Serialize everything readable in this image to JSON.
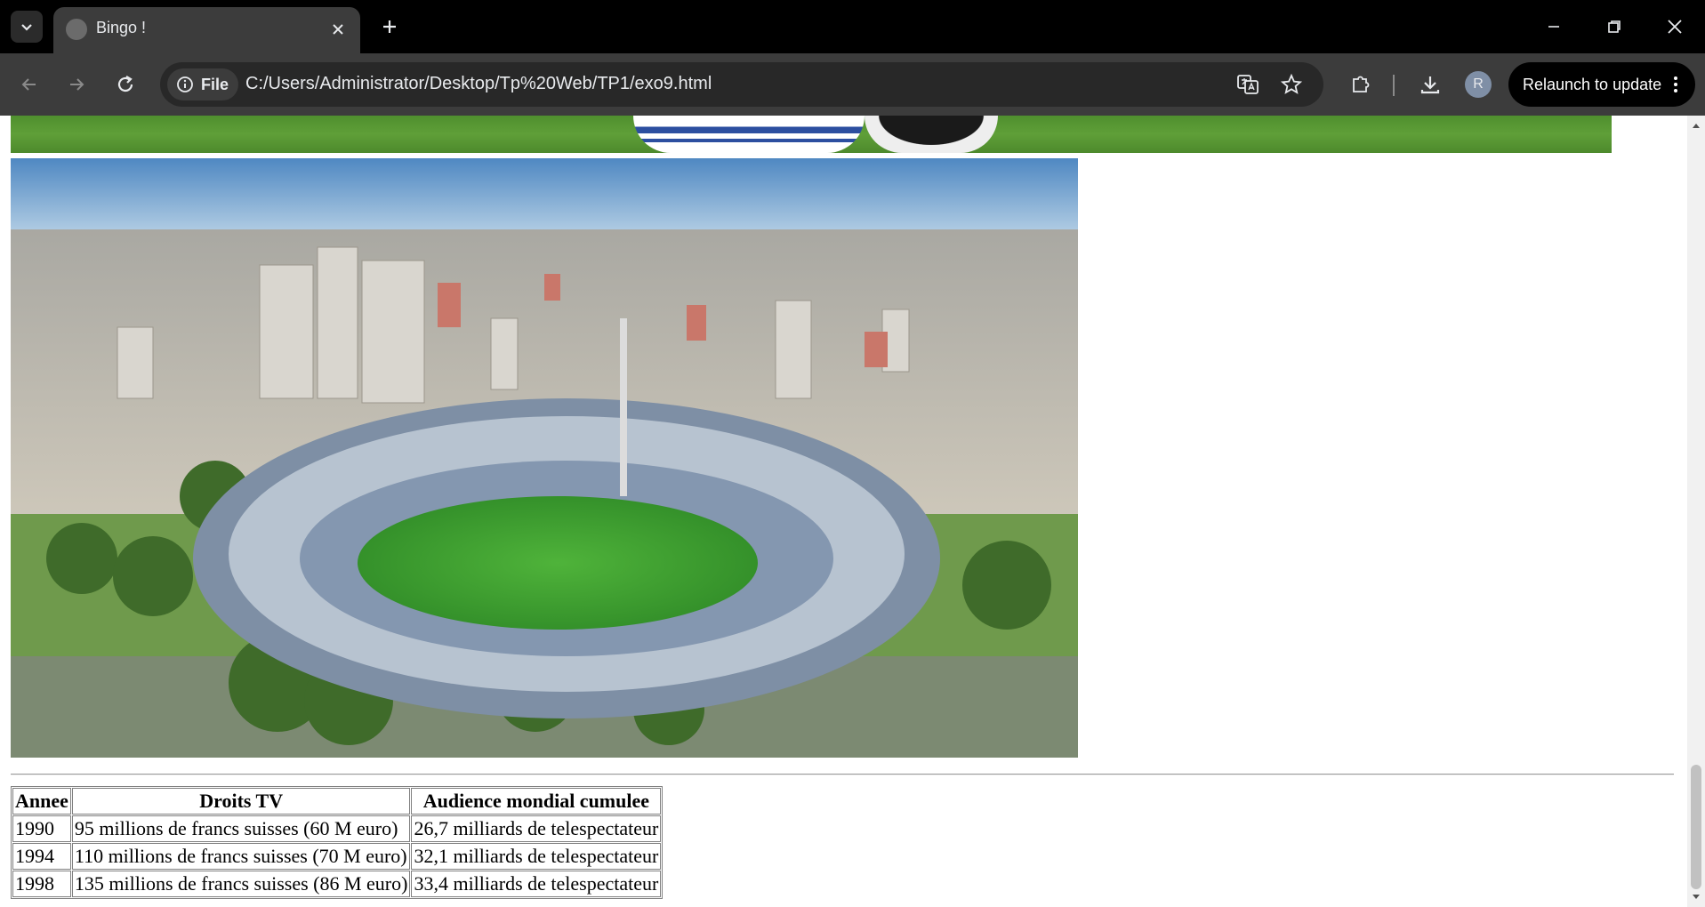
{
  "browser": {
    "tab_title": "Bingo !",
    "url": "C:/Users/Administrator/Desktop/Tp%20Web/TP1/exo9.html",
    "file_chip_label": "File",
    "relaunch_label": "Relaunch to update",
    "avatar_initial": "R"
  },
  "table": {
    "headers": [
      "Annee",
      "Droits TV",
      "Audience mondial cumulee"
    ],
    "rows": [
      [
        "1990",
        "95 millions de francs suisses (60 M euro)",
        "26,7 milliards de telespectateur"
      ],
      [
        "1994",
        "110 millions de francs suisses (70 M euro)",
        "32,1 milliards de telespectateur"
      ],
      [
        "1998",
        "135 millions de francs suisses (86 M euro)",
        "33,4 milliards de telespectateur"
      ]
    ]
  }
}
